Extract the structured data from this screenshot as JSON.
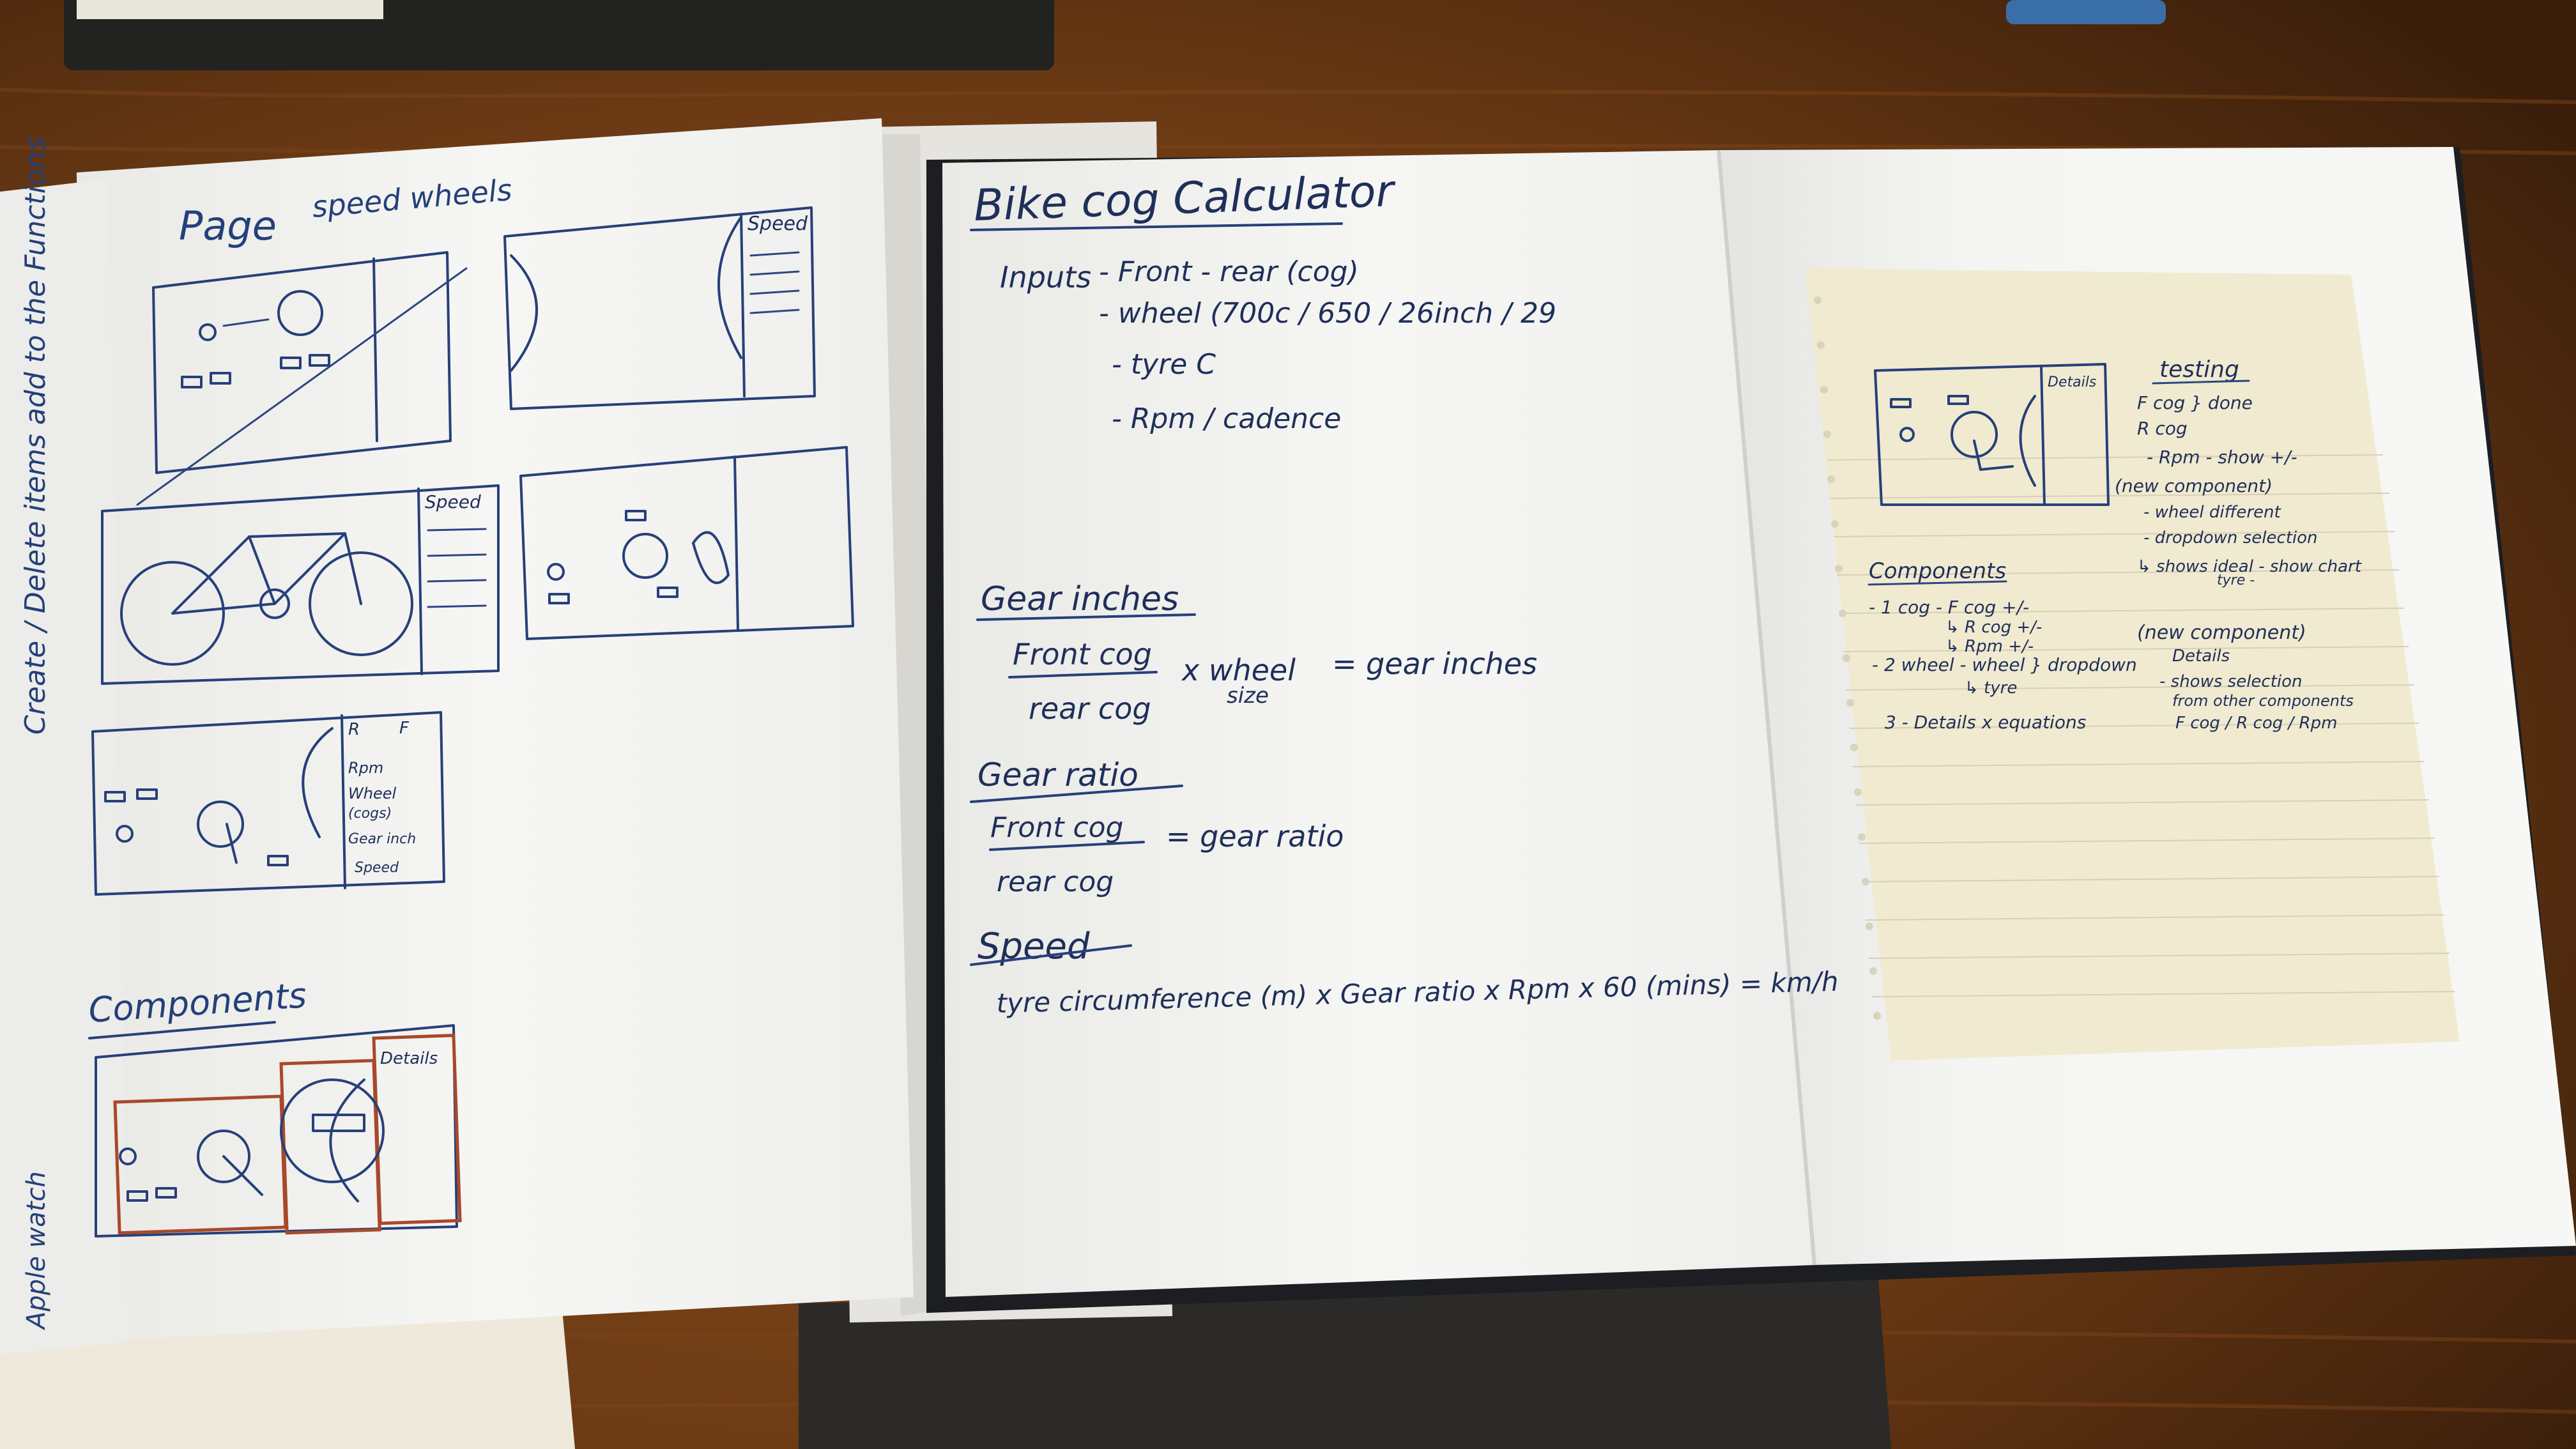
{
  "left_page": {
    "header_left": "Page",
    "header_right": "speed wheels",
    "margin_note_1": "Create / Delete items add to the Functions",
    "margin_note_2": "Apple watch",
    "speed_label_1": "Speed",
    "speed_label_2": "Speed",
    "sidebar_sketch_lines": [
      "R",
      "F",
      "Rpm",
      "Wheel",
      "(cogs)",
      "Gear inch",
      "Speed"
    ],
    "components_title": "Components",
    "details_label": "Details"
  },
  "middle_page": {
    "title": "Bike cog Calculator",
    "inputs_label": "Inputs",
    "input_lines": [
      "- Front - rear (cog)",
      "- wheel (700c / 650 / 26inch / 29",
      "- tyre C",
      "- Rpm / cadence"
    ],
    "gear_inches": {
      "heading": "Gear inches",
      "numerator": "Front cog",
      "denominator": "rear cog",
      "times": "x wheel",
      "size": "size",
      "result": "= gear inches"
    },
    "gear_ratio": {
      "heading": "Gear ratio",
      "numerator": "Front cog",
      "denominator": "rear cog",
      "result": "= gear ratio"
    },
    "speed": {
      "heading": "Speed",
      "formula": "tyre circumference (m) x Gear ratio x Rpm x 60 (mins) = km/h"
    }
  },
  "sticky_note": {
    "panel_label": "Details",
    "testing_title": "testing",
    "testing_lines": [
      "F cog } done",
      "R cog",
      "- Rpm - show +/-",
      "(new component)",
      "- wheel different",
      "- dropdown selection",
      "↳ shows ideal - show chart",
      "tyre -"
    ],
    "components_title": "Components",
    "component_lines": [
      "- 1 cog  - F cog +/-",
      "↳ R cog +/-",
      "↳ Rpm +/-",
      "- 2 wheel - wheel } dropdown",
      "↳ tyre",
      "3 - Details x equations"
    ],
    "new_component_title": "(new component)",
    "new_component_lines": [
      "Details",
      "- shows selection",
      "from other components",
      "F cog / R cog / Rpm"
    ]
  },
  "colors": {
    "desk": "#6a3a14",
    "paper": "#f4f4f2",
    "sticky": "#f0ead0",
    "ink": "#27407a",
    "red_ink": "#a8492a"
  }
}
